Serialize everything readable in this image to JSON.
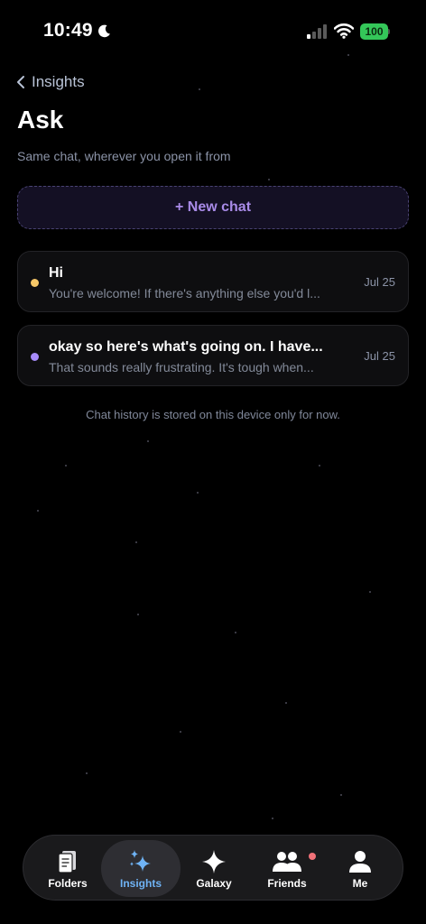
{
  "status_bar": {
    "time": "10:49",
    "battery": "100"
  },
  "header": {
    "back_label": "Insights",
    "title": "Ask",
    "subtitle": "Same chat, wherever you open it from"
  },
  "new_chat": {
    "label": "+ New chat"
  },
  "chats": [
    {
      "title": "Hi",
      "preview": "You're welcome! If there's anything else you'd l...",
      "date": "Jul 25",
      "dot_color": "#f6c768"
    },
    {
      "title": "okay so here's what's going on. I have...",
      "preview": "That sounds really frustrating. It's tough when...",
      "date": "Jul 25",
      "dot_color": "#a78bfa"
    }
  ],
  "history_note": "Chat history is stored on this device only for now.",
  "tabs": [
    {
      "label": "Folders",
      "icon": "notebook-icon",
      "active": false
    },
    {
      "label": "Insights",
      "icon": "sparkles-icon",
      "active": true
    },
    {
      "label": "Galaxy",
      "icon": "star-sparkle-icon",
      "active": false
    },
    {
      "label": "Friends",
      "icon": "people-icon",
      "active": false,
      "notification_color": "#f07178"
    },
    {
      "label": "Me",
      "icon": "person-icon",
      "active": false
    }
  ],
  "colors": {
    "accent": "#a98be8",
    "active_tab": "#6fb3f5",
    "background": "#000000",
    "battery": "#34c759"
  }
}
